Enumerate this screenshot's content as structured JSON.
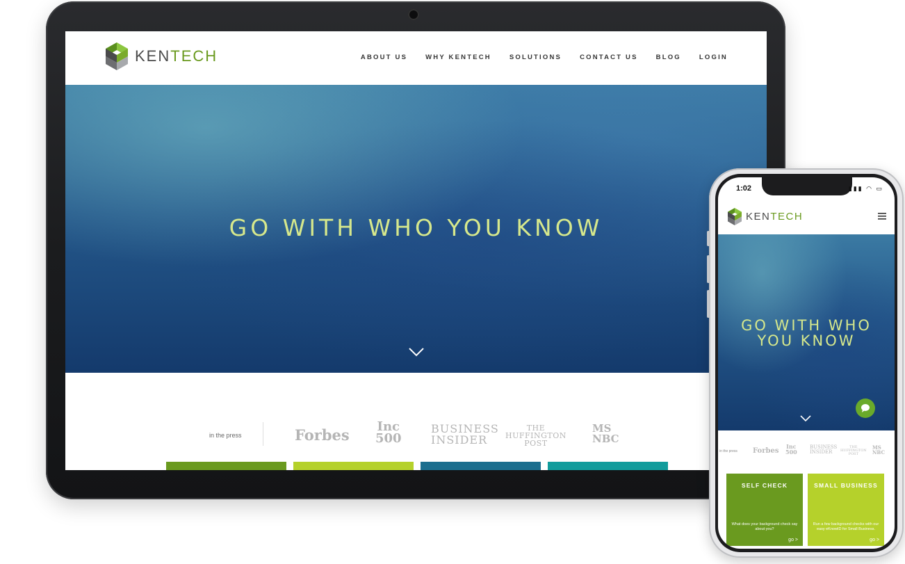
{
  "colors": {
    "brand_green": "#6a9a1f",
    "hero_text": "#d6e88c",
    "card_green": "#6a9a1f",
    "card_lime": "#b5d12b",
    "card_blue": "#1c6e8e",
    "card_teal": "#129c9c"
  },
  "brand": {
    "name_part1": "KEN",
    "name_part2": "TECH"
  },
  "tablet": {
    "nav": [
      "ABOUT US",
      "WHY KENTECH",
      "SOLUTIONS",
      "CONTACT US",
      "BLOG",
      "LOGIN"
    ],
    "hero_title": "GO WITH WHO YOU KNOW",
    "press_label": "in the press",
    "press_logos": {
      "forbes": "Forbes",
      "inc": "Inc",
      "inc_num": "500",
      "bi_1": "BUSINESS",
      "bi_2": "INSIDER",
      "huff_1": "THE",
      "huff_2": "HUFFINGTON",
      "huff_3": "POST",
      "msnbc_1": "MS",
      "msnbc_2": "NBC"
    }
  },
  "phone": {
    "time": "1:02",
    "status_icons": "▮▮▮ ◠ ▭",
    "hero_title_1": "GO WITH WHO",
    "hero_title_2": "YOU KNOW",
    "press_label": "in the press",
    "cards": [
      {
        "title": "SELF CHECK",
        "text": "What does your background check say about you?",
        "go": "go >"
      },
      {
        "title": "SMALL BUSINESS",
        "text": "Run a few background checks with our easy eKnowID for Small Business.",
        "go": "go >"
      }
    ]
  }
}
